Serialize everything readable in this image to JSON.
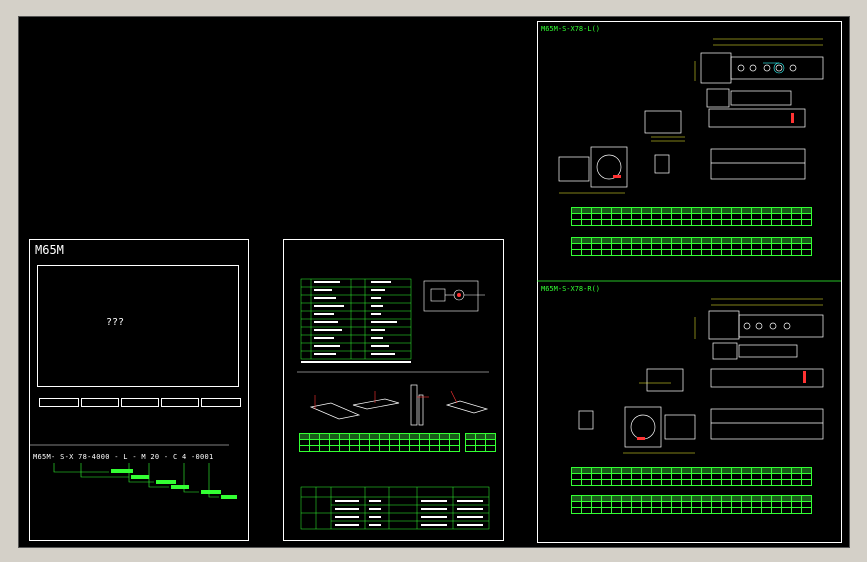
{
  "left_sheet": {
    "title": "M65M",
    "placeholder": "???",
    "buttons": [
      "",
      "",
      "",
      "",
      ""
    ],
    "model_heading": "",
    "model_code": "M65M- S-X 78-4000 - L - M 20 - C 4 -0001"
  },
  "middle_sheet": {
    "section1": "",
    "section2": "",
    "section3": "",
    "section4": "",
    "section5": ""
  },
  "right_top": {
    "title": "M65M-S-X78-L(",
    "title_suffix": ")"
  },
  "right_bottom": {
    "title": "M65M-S-X78-R(",
    "title_suffix": ")"
  },
  "colors": {
    "background": "#000000",
    "frame": "#ffffff",
    "table": "#33ff33",
    "dimension": "#ffff33",
    "accent": "#33ffff",
    "marker": "#ff3333"
  }
}
